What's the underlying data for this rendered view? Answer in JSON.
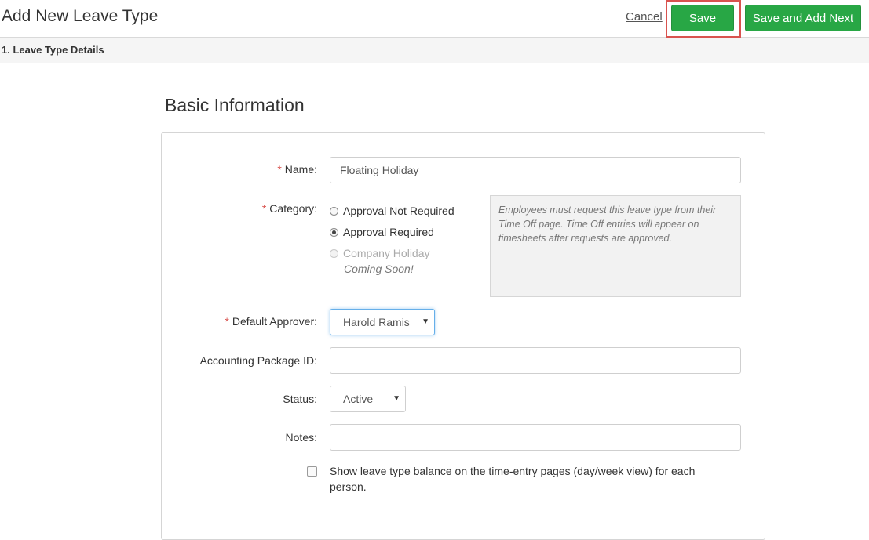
{
  "header": {
    "title": "Add New Leave Type",
    "cancel_label": "Cancel",
    "save_label": "Save",
    "save_next_label": "Save and Add Next"
  },
  "section": {
    "label": "1. Leave Type Details"
  },
  "form": {
    "heading": "Basic Information",
    "required_marker": "*",
    "name": {
      "label": "Name:",
      "value": "Floating Holiday"
    },
    "category": {
      "label": "Category:",
      "options": [
        {
          "label": "Approval Not Required",
          "selected": false,
          "disabled": false
        },
        {
          "label": "Approval Required",
          "selected": true,
          "disabled": false
        },
        {
          "label": "Company Holiday",
          "selected": false,
          "disabled": true
        }
      ],
      "coming_soon": "Coming Soon!",
      "help_text": "Employees must request this leave type from their Time Off page. Time Off entries will appear on timesheets after requests are approved."
    },
    "default_approver": {
      "label": "Default Approver:",
      "value": "Harold Ramis"
    },
    "accounting_package_id": {
      "label": "Accounting Package ID:",
      "value": ""
    },
    "status": {
      "label": "Status:",
      "value": "Active"
    },
    "notes": {
      "label": "Notes:",
      "value": ""
    },
    "show_balance": {
      "label": "Show leave type balance on the time-entry pages (day/week view) for each person.",
      "checked": false
    }
  },
  "colors": {
    "accent_green": "#28a745",
    "required_red": "#d9534f",
    "highlight_red": "#d9534f"
  },
  "icons": {
    "select_caret": "caret-down-icon"
  }
}
